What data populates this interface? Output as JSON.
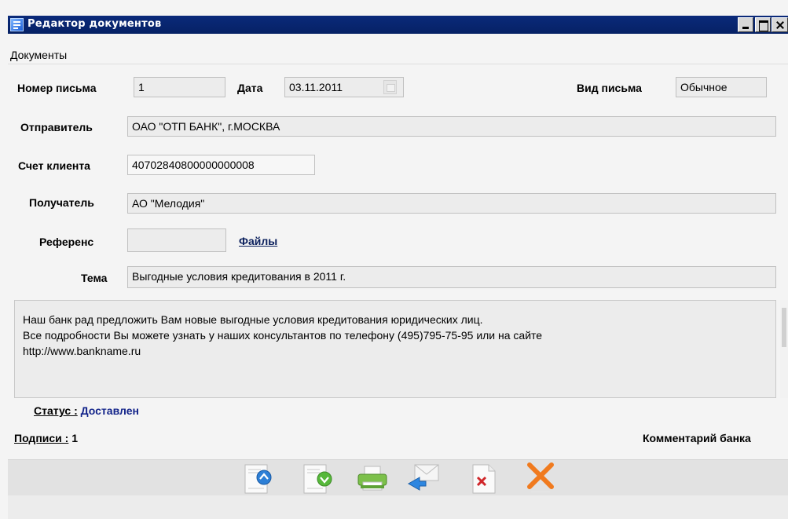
{
  "window": {
    "title": "Редактор документов"
  },
  "menu": {
    "documents": "Документы"
  },
  "form": {
    "letter_number_label": "Номер письма",
    "letter_number": "1",
    "date_label": "Дата",
    "date": "03.11.2011",
    "letter_type_label": "Вид письма",
    "letter_type": "Обычное",
    "sender_label": "Отправитель",
    "sender": "ОАО \"ОТП БАНК\", г.МОСКВА",
    "account_label": "Счет клиента",
    "account": "40702840800000000008",
    "recipient_label": "Получатель",
    "recipient": "АО \"Мелодия\"",
    "reference_label": "Референс",
    "reference": "",
    "files_link": "Файлы",
    "subject_label": "Тема",
    "subject": "Выгодные условия кредитования в 2011 г."
  },
  "message": {
    "lines": [
      "Наш банк рад предложить Вам новые выгодные условия кредитования юридических лиц.",
      "Все подробности Вы можете узнать у наших консультантов по телефону (495)795-75-95 или на сайте",
      "http://www.bankname.ru"
    ]
  },
  "status": {
    "status_label": "Статус :",
    "status_value": "Доставлен",
    "signatures_label": "Подписи :",
    "signatures_count": "1",
    "bank_comment": "Комментарий банка"
  },
  "toolbar": {
    "icons": [
      "doc-up-icon",
      "doc-down-icon",
      "printer-icon",
      "envelope-reply-icon",
      "doc-delete-icon",
      "close-x-icon"
    ]
  },
  "colors": {
    "titlebar": "#062165",
    "status_value": "#13248a",
    "files_link": "#0a1f5c"
  }
}
